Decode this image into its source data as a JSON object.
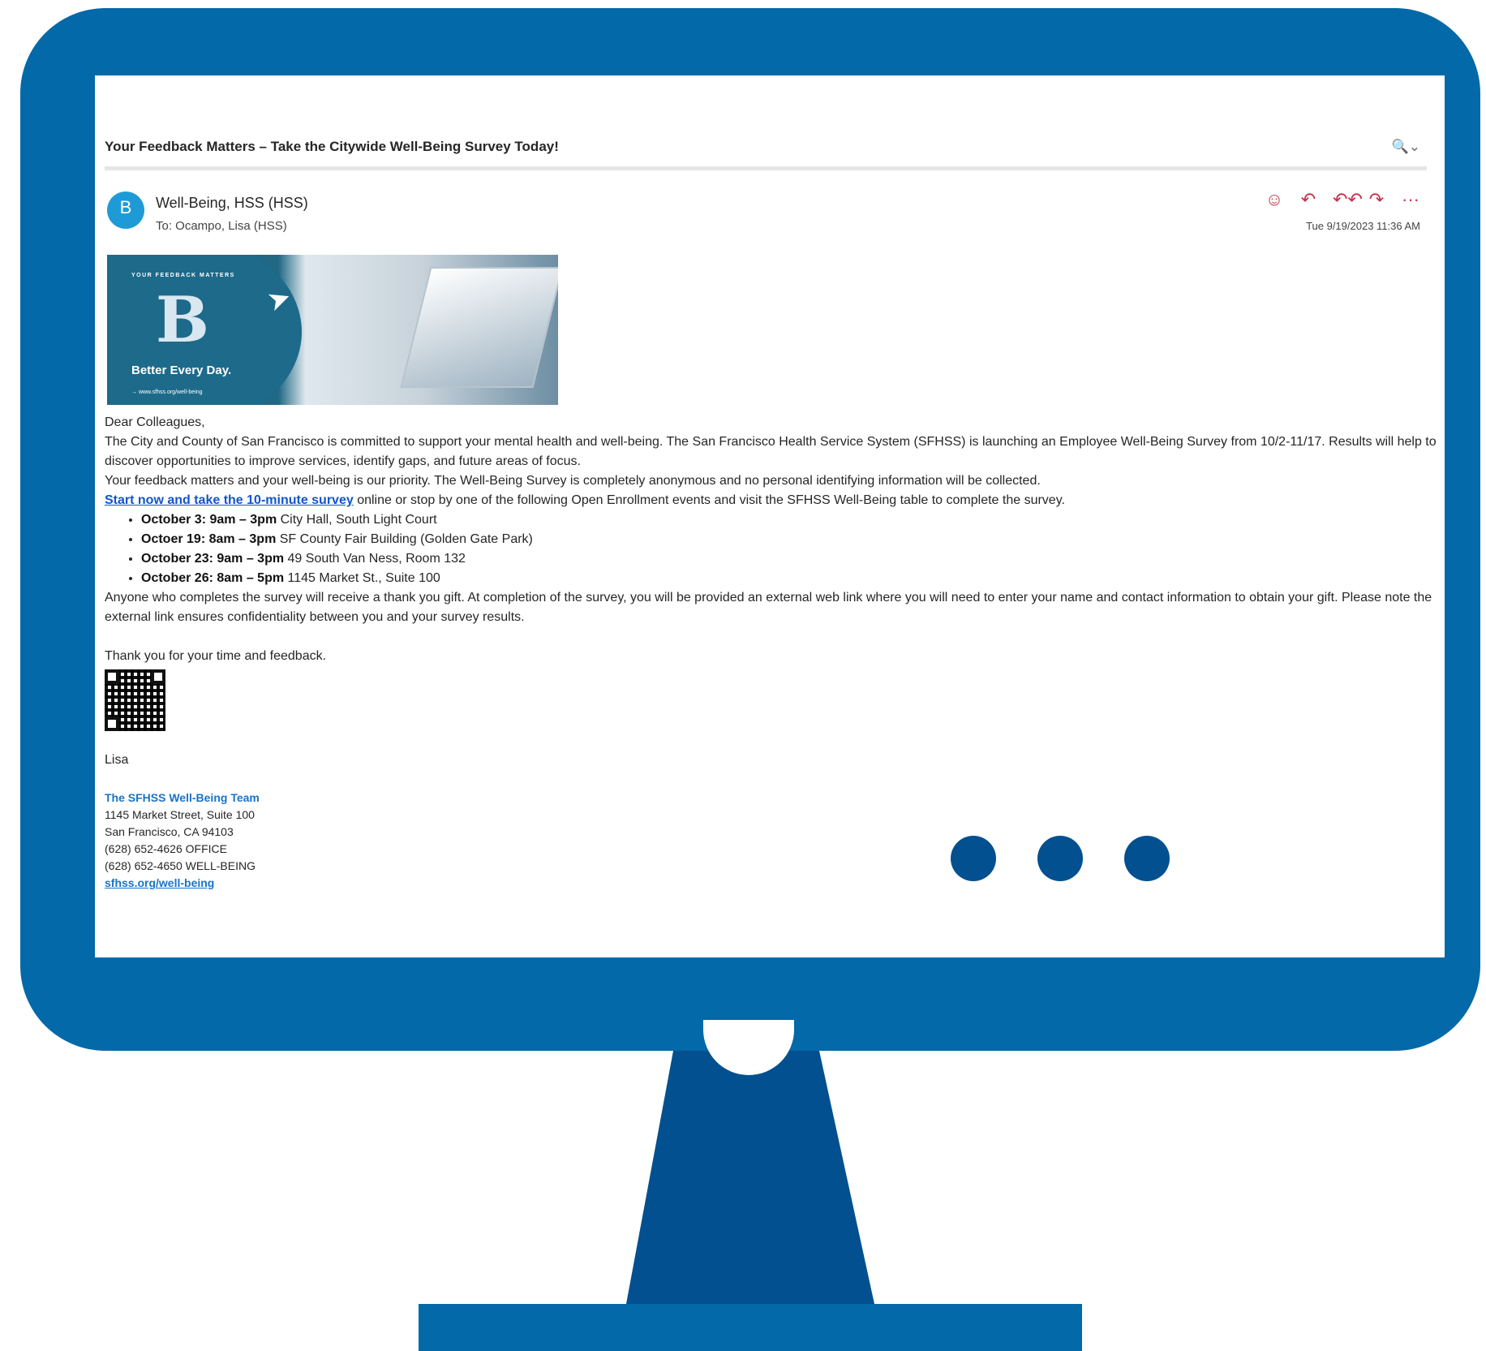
{
  "email": {
    "subject": "Your Feedback Matters – Take the Citywide Well-Being Survey Today!",
    "zoom_label": "🔍⌄",
    "sender_initial": "B",
    "sender": "Well-Being, HSS (HSS)",
    "to": "To:  Ocampo, Lisa (HSS)",
    "date": "Tue 9/19/2023 11:36 AM",
    "actions": {
      "emoji": "☺",
      "reply": "↶",
      "reply_all": "↶↶",
      "forward": "↷",
      "more": "···"
    }
  },
  "banner": {
    "eyebrow": "YOUR FEEDBACK MATTERS",
    "letter": "B",
    "tagline": "Better Every Day.",
    "url": "→  www.sfhss.org/well-being"
  },
  "body": {
    "greeting": "Dear Colleagues,",
    "p1": "The City and County of San Francisco is committed to support your mental health and well-being. The San Francisco Health Service System (SFHSS) is launching an Employee Well-Being Survey from 10/2-11/17. Results will help to discover opportunities to improve services, identify gaps, and future areas of focus.",
    "p2": "Your feedback matters and your well-being is our priority. The Well-Being Survey is completely anonymous and no personal identifying information will be collected.",
    "link": "Start now and take the 10-minute survey",
    "p3_rest": " online or stop by one of the following Open Enrollment events and visit the SFHSS Well-Being table to complete the survey.",
    "events": [
      {
        "when": "October 3: 9am – 3pm",
        "where": " City Hall, South Light Court"
      },
      {
        "when": "Octoer 19: 8am – 3pm",
        "where": " SF County Fair Building (Golden Gate Park)"
      },
      {
        "when": "October 23: 9am – 3pm",
        "where": " 49 South Van Ness, Room 132"
      },
      {
        "when": "October 26: 8am – 5pm",
        "where": " 1145 Market St., Suite 100"
      }
    ],
    "p4": "Anyone who completes the survey will receive a thank you gift. At completion of the survey, you will be provided an external web link where you will need to enter your name and contact information to obtain your gift. Please note the external link ensures confidentiality between you and your survey results.",
    "thanks": "Thank you for your time and feedback.",
    "name": "Lisa"
  },
  "signature": {
    "team": "The SFHSS Well-Being Team",
    "address1": "1145 Market Street, Suite 100",
    "address2": "San Francisco, CA 94103",
    "phone1": "(628) 652-4626   OFFICE",
    "phone2": "(628) 652-4650   WELL-BEING",
    "web": "sfhss.org/well-being"
  },
  "colors": {
    "monitor": "#0369a8",
    "stand": "#02508f",
    "link": "#1155cc",
    "action": "#c4314b"
  }
}
